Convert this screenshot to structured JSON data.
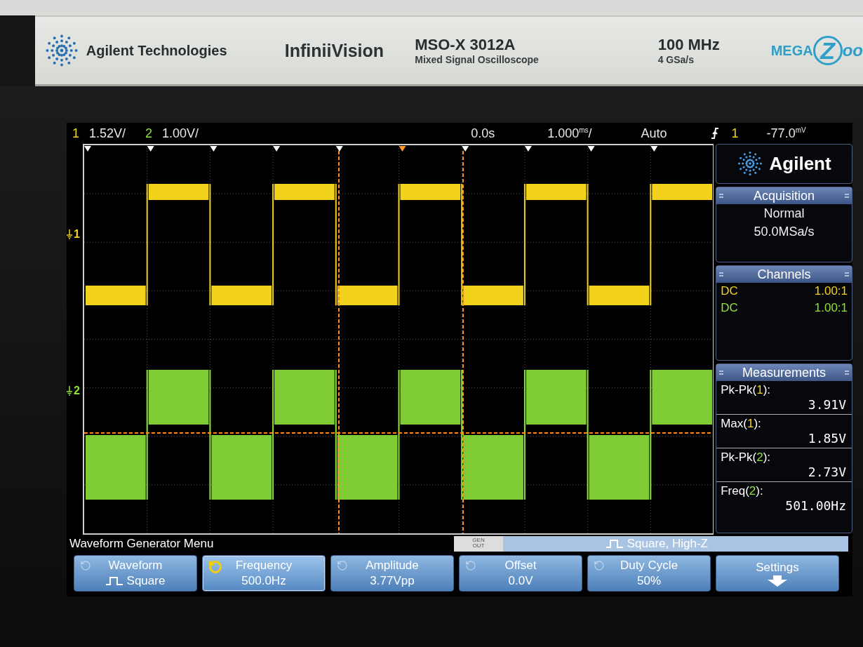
{
  "bezel": {
    "brand": "Agilent Technologies",
    "product": "InfiniiVision",
    "model": "MSO-X 3012A",
    "model_subtitle": "Mixed Signal Oscilloscope",
    "bandwidth": "100 MHz",
    "sample_rate": "4 GSa/s",
    "logo_parts": [
      "MEGA",
      "Z",
      "oo"
    ]
  },
  "status_bar": {
    "scales": [
      {
        "channel": "1",
        "value": "1.52V/",
        "color": "#f2d21b"
      },
      {
        "channel": "2",
        "value": "1.00V/",
        "color": "#8ee23a"
      }
    ],
    "delay": "0.0s",
    "timebase": {
      "value": "1.000",
      "unit": "ms",
      "suffix": "/"
    },
    "mode": "Auto",
    "trigger_channel": "1",
    "trigger_level": {
      "value": "-77.0",
      "unit": "mV"
    }
  },
  "markers": [
    {
      "label": "1",
      "color": "#f2d21b"
    },
    {
      "label": "2",
      "color": "#8ee23a"
    }
  ],
  "side_panel": {
    "logo": "Agilent",
    "acquisition": {
      "title": "Acquisition",
      "mode": "Normal",
      "rate": "50.0MSa/s"
    },
    "channels": {
      "title": "Channels",
      "rows": [
        {
          "coupling": "DC",
          "probe": "1.00:1",
          "color": "#f2d21b"
        },
        {
          "coupling": "DC",
          "probe": "1.00:1",
          "color": "#8ee23a"
        }
      ]
    },
    "measurements": {
      "title": "Measurements",
      "rows": [
        {
          "before": "Pk-Pk(",
          "source": "1",
          "after": "):",
          "value": "3.91V",
          "color": "#f2d21b"
        },
        {
          "before": "Max(",
          "source": "1",
          "after": "):",
          "value": "1.85V",
          "color": "#f2d21b"
        },
        {
          "before": "Pk-Pk(",
          "source": "2",
          "after": "):",
          "value": "2.73V",
          "color": "#8ee23a"
        },
        {
          "before": "Freq(",
          "source": "2",
          "after": "):",
          "value": "501.00Hz",
          "color": "#8ee23a"
        }
      ]
    }
  },
  "menu": {
    "title": "Waveform Generator Menu",
    "gen_out": "GEN OUT",
    "status": "Square, High-Z"
  },
  "softkeys": [
    {
      "label": "Waveform",
      "value": "Square",
      "kind": "select",
      "selected": false
    },
    {
      "label": "Frequency",
      "value": "500.0Hz",
      "kind": "knob",
      "selected": true
    },
    {
      "label": "Amplitude",
      "value": "3.77Vpp",
      "kind": "knob",
      "selected": false
    },
    {
      "label": "Offset",
      "value": "0.0V",
      "kind": "knob",
      "selected": false
    },
    {
      "label": "Duty Cycle",
      "value": "50%",
      "kind": "knob",
      "selected": false
    },
    {
      "label": "Settings",
      "kind": "submenu",
      "selected": false
    }
  ]
}
